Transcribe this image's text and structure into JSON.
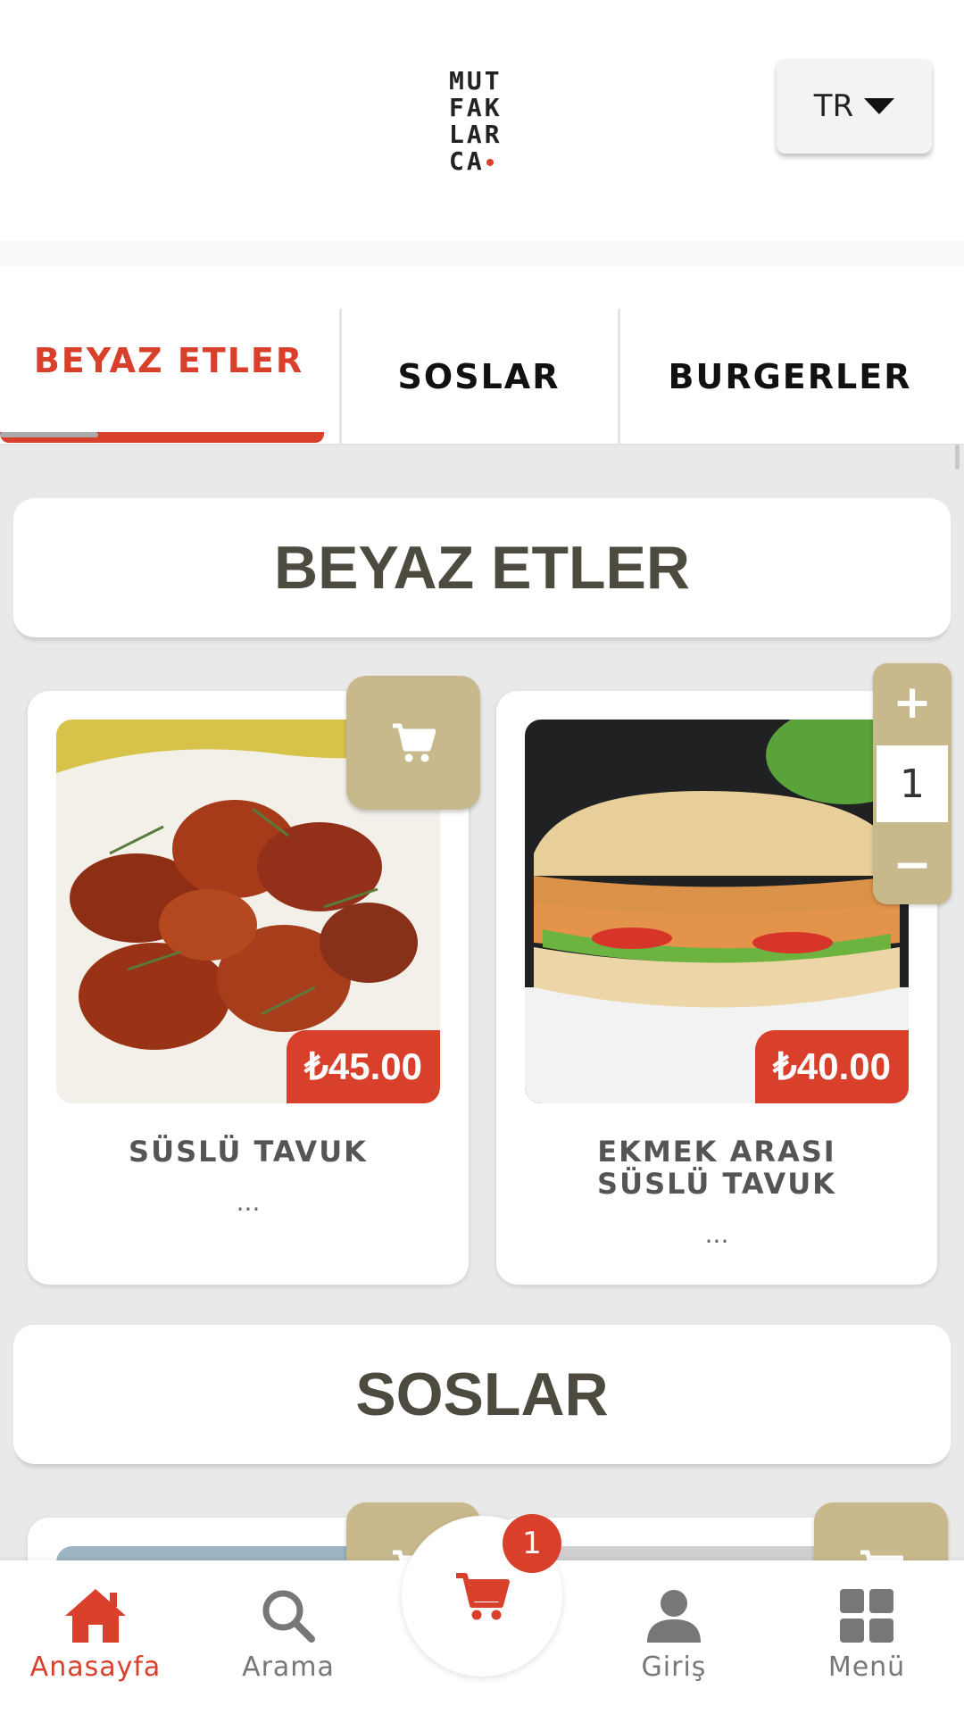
{
  "header": {
    "logo_lines": [
      "MUT",
      "FAK",
      "LAR",
      "CA"
    ],
    "language": "TR"
  },
  "tabs": [
    {
      "label": "BEYAZ ETLER",
      "active": true
    },
    {
      "label": "SOSLAR",
      "active": false
    },
    {
      "label": "BURGERLER",
      "active": false
    }
  ],
  "sections": [
    {
      "title": "BEYAZ ETLER",
      "products": [
        {
          "name": "SÜSLÜ TAVUK",
          "price": "₺45.00",
          "description": "...",
          "in_cart": false
        },
        {
          "name_line1": "EKMEK ARASI",
          "name_line2": "SÜSLÜ TAVUK",
          "price": "₺40.00",
          "description": "...",
          "quantity": "1"
        }
      ]
    },
    {
      "title": "SOSLAR"
    }
  ],
  "stepper": {
    "plus": "+",
    "minus": "−"
  },
  "bottom_nav": {
    "home": "Anasayfa",
    "search": "Arama",
    "cart_count": "1",
    "login": "Giriş",
    "menu": "Menü"
  },
  "colors": {
    "accent": "#d8402c",
    "gold": "#c8b98c",
    "heading": "#4d4a40"
  }
}
